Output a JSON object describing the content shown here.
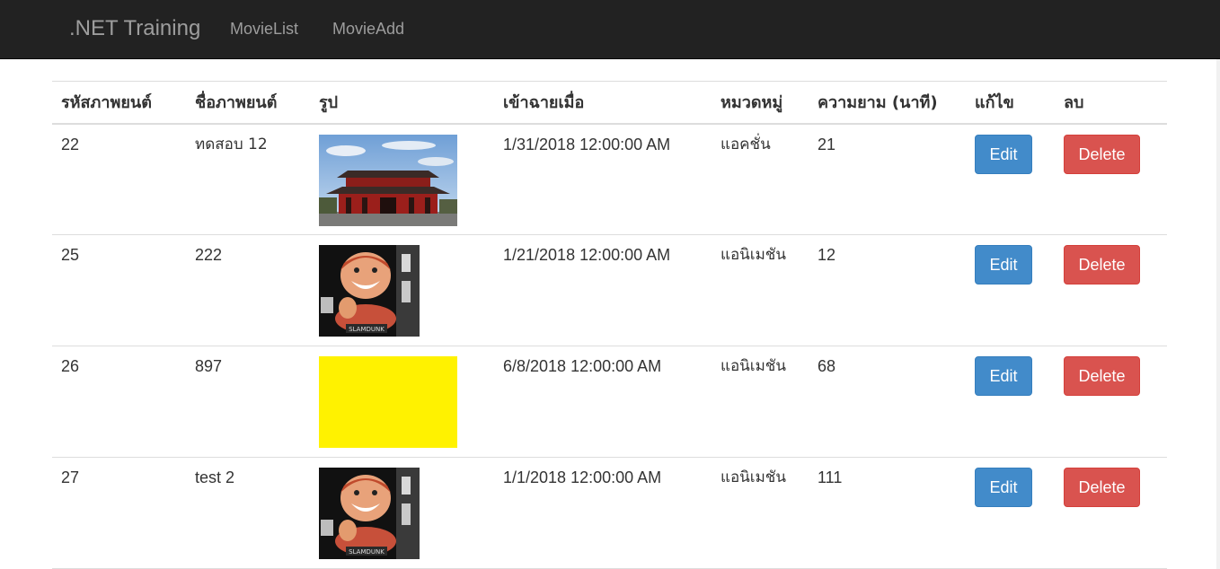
{
  "navbar": {
    "brand": ".NET Training",
    "links": [
      "MovieList",
      "MovieAdd"
    ]
  },
  "table": {
    "headers": [
      "รหัสภาพยนต์",
      "ชื่อภาพยนต์",
      "รูป",
      "เข้าฉายเมื่อ",
      "หมวดหมู่",
      "ความยาม (นาที)",
      "แก้ไข",
      "ลบ"
    ],
    "rows": [
      {
        "id": "22",
        "name": "ทดสอบ 12",
        "image": "temple-photo",
        "release": "1/31/2018 12:00:00 AM",
        "category": "แอคชั่น",
        "length": "21",
        "edit": "Edit",
        "delete": "Delete"
      },
      {
        "id": "25",
        "name": "222",
        "image": "cartoon-figure-photo",
        "release": "1/21/2018 12:00:00 AM",
        "category": "แอนิเมชัน",
        "length": "12",
        "edit": "Edit",
        "delete": "Delete"
      },
      {
        "id": "26",
        "name": "897",
        "image": "yellow-image",
        "release": "6/8/2018 12:00:00 AM",
        "category": "แอนิเมชัน",
        "length": "68",
        "edit": "Edit",
        "delete": "Delete"
      },
      {
        "id": "27",
        "name": "test 2",
        "image": "cartoon-figure-photo",
        "release": "1/1/2018 12:00:00 AM",
        "category": "แอนิเมชัน",
        "length": "111",
        "edit": "Edit",
        "delete": "Delete"
      }
    ]
  },
  "colors": {
    "navbar_bg": "#222222",
    "nav_text": "#9d9d9d",
    "edit_button": "#428bca",
    "delete_button": "#d9534f",
    "yellow_image": "#fff200"
  }
}
